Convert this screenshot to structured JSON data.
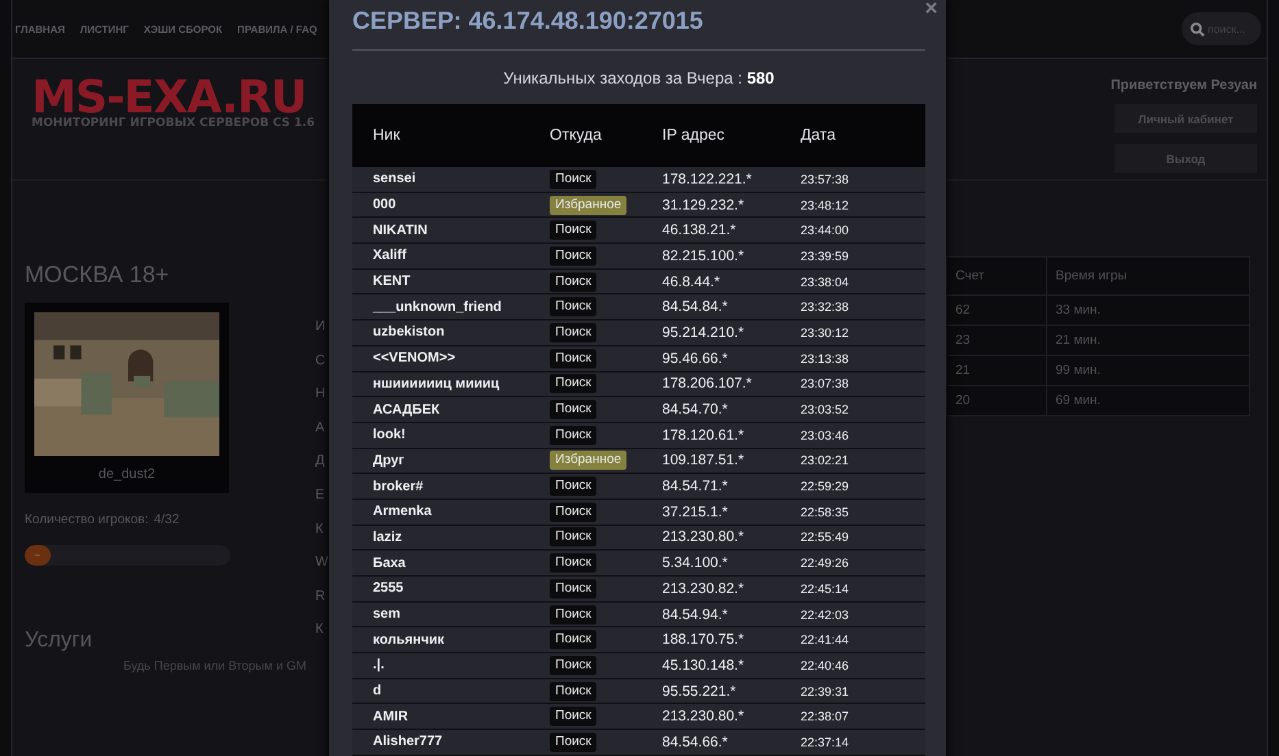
{
  "nav": {
    "items": [
      "ГЛАВНАЯ",
      "ЛИСТИНГ",
      "ХЭШИ СБОРОК",
      "ПРАВИЛА / FAQ"
    ],
    "search": {
      "placeholder": "поиск..."
    }
  },
  "header": {
    "logo": "MS-EXA.RU",
    "tagline": "МОНИТОРИНГ ИГРОВЫХ СЕРВЕРОВ CS 1.6",
    "greeting": "Приветствуем Резуан",
    "buttons": [
      "Личный кабинет",
      "Выход"
    ]
  },
  "server": {
    "name": "МОСКВА 18+",
    "map": "de_dust2",
    "players_label": "Количество игроков:",
    "players": "4/32",
    "players_bar": {
      "level": 0.125,
      "text": "~"
    },
    "info_letters": [
      "И",
      "С",
      "Н",
      "А",
      "Д",
      "Е",
      "К",
      "W",
      "R",
      "К"
    ],
    "players_table": {
      "columns": [
        "Счет",
        "Время игры"
      ],
      "rows": [
        [
          "62",
          "33 мин."
        ],
        [
          "23",
          "21 мин."
        ],
        [
          "21",
          "99 мин."
        ],
        [
          "20",
          "69 мин."
        ]
      ]
    }
  },
  "services": {
    "title": "Услуги",
    "text": "Будь Первым или Вторым и GM"
  },
  "modal": {
    "title": "СЕРВЕР: 46.174.48.190:27015",
    "close": "×",
    "summary": "Уникальных заходов за Вчера : **580**",
    "columns": [
      "Ник",
      "Откуда",
      "IP адрес",
      "Дата"
    ],
    "rows": [
      {
        "nick": "sensei",
        "source": "Поиск",
        "kind": "search",
        "ip": "178.122.221.*",
        "time": "23:57:38"
      },
      {
        "nick": "000",
        "source": "Избранное",
        "kind": "favorite",
        "ip": "31.129.232.*",
        "time": "23:48:12"
      },
      {
        "nick": "NIKATIN",
        "source": "Поиск",
        "kind": "search",
        "ip": "46.138.21.*",
        "time": "23:44:00"
      },
      {
        "nick": "Xaliff",
        "source": "Поиск",
        "kind": "search",
        "ip": "82.215.100.*",
        "time": "23:39:59"
      },
      {
        "nick": "KENT",
        "source": "Поиск",
        "kind": "search",
        "ip": "46.8.44.*",
        "time": "23:38:04"
      },
      {
        "nick": "___unknown_friend",
        "source": "Поиск",
        "kind": "search",
        "ip": "84.54.84.*",
        "time": "23:32:38"
      },
      {
        "nick": "uzbekiston",
        "source": "Поиск",
        "kind": "search",
        "ip": "95.214.210.*",
        "time": "23:30:12"
      },
      {
        "nick": "<<VENOM>>",
        "source": "Поиск",
        "kind": "search",
        "ip": "95.46.66.*",
        "time": "23:13:38"
      },
      {
        "nick": "ншииииииц миииц",
        "source": "Поиск",
        "kind": "search",
        "ip": "178.206.107.*",
        "time": "23:07:38"
      },
      {
        "nick": "АСАДБЕК",
        "source": "Поиск",
        "kind": "search",
        "ip": "84.54.70.*",
        "time": "23:03:52"
      },
      {
        "nick": "look!",
        "source": "Поиск",
        "kind": "search",
        "ip": "178.120.61.*",
        "time": "23:03:46"
      },
      {
        "nick": "Друг",
        "source": "Избранное",
        "kind": "favorite",
        "ip": "109.187.51.*",
        "time": "23:02:21"
      },
      {
        "nick": "broker#",
        "source": "Поиск",
        "kind": "search",
        "ip": "84.54.71.*",
        "time": "22:59:29"
      },
      {
        "nick": "Armenka",
        "source": "Поиск",
        "kind": "search",
        "ip": "37.215.1.*",
        "time": "22:58:35"
      },
      {
        "nick": "laziz",
        "source": "Поиск",
        "kind": "search",
        "ip": "213.230.80.*",
        "time": "22:55:49"
      },
      {
        "nick": "Баха",
        "source": "Поиск",
        "kind": "search",
        "ip": "5.34.100.*",
        "time": "22:49:26"
      },
      {
        "nick": "2555",
        "source": "Поиск",
        "kind": "search",
        "ip": "213.230.82.*",
        "time": "22:45:14"
      },
      {
        "nick": "sem",
        "source": "Поиск",
        "kind": "search",
        "ip": "84.54.94.*",
        "time": "22:42:03"
      },
      {
        "nick": "кольянчик",
        "source": "Поиск",
        "kind": "search",
        "ip": "188.170.75.*",
        "time": "22:41:44"
      },
      {
        "nick": ".|.",
        "source": "Поиск",
        "kind": "search",
        "ip": "45.130.148.*",
        "time": "22:40:46"
      },
      {
        "nick": "d",
        "source": "Поиск",
        "kind": "search",
        "ip": "95.55.221.*",
        "time": "22:39:31"
      },
      {
        "nick": "AMIR",
        "source": "Поиск",
        "kind": "search",
        "ip": "213.230.80.*",
        "time": "22:38:07"
      },
      {
        "nick": "Alisher777",
        "source": "Поиск",
        "kind": "search",
        "ip": "84.54.66.*",
        "time": "22:37:14"
      }
    ]
  }
}
